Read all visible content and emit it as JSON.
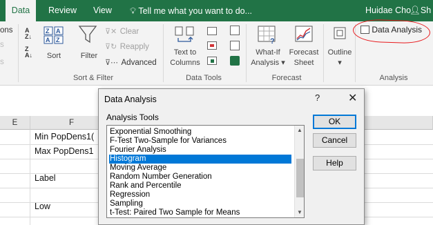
{
  "tabs": [
    "Data",
    "Review",
    "View"
  ],
  "tell_me": "Tell me what you want to do...",
  "user_name": "Huidae Cho",
  "share_label": "Sh",
  "ribbon": {
    "partial_left_top": "ons",
    "sort_label": "Sort",
    "filter_label": "Filter",
    "clear_label": "Clear",
    "reapply_label": "Reapply",
    "advanced_label": "Advanced",
    "sort_filter_group": "Sort & Filter",
    "text_to_columns_line1": "Text to",
    "text_to_columns_line2": "Columns",
    "data_tools_group": "Data Tools",
    "whatif_line1": "What-If",
    "whatif_line2": "Analysis",
    "forecast_line1": "Forecast",
    "forecast_line2": "Sheet",
    "forecast_group": "Forecast",
    "outline_label": "Outline",
    "data_analysis_label": "Data Analysis",
    "analysis_group": "Analysis"
  },
  "sheet": {
    "col_e": "E",
    "col_f": "F",
    "cells": [
      "Min PopDens1(",
      "Max PopDens1",
      "Label",
      "Low"
    ]
  },
  "dialog": {
    "title": "Data Analysis",
    "help_glyph": "?",
    "close_glyph": "✕",
    "tools_label": "Analysis Tools",
    "items": [
      "Exponential Smoothing",
      "F-Test Two-Sample for Variances",
      "Fourier Analysis",
      "Histogram",
      "Moving Average",
      "Random Number Generation",
      "Rank and Percentile",
      "Regression",
      "Sampling",
      "t-Test: Paired Two Sample for Means"
    ],
    "selected_item": "Histogram",
    "ok_label": "OK",
    "cancel_label": "Cancel",
    "help_label": "Help"
  },
  "colors": {
    "excel_green": "#217346",
    "selection_blue": "#0078d7",
    "annotation_red": "#e8181b"
  }
}
